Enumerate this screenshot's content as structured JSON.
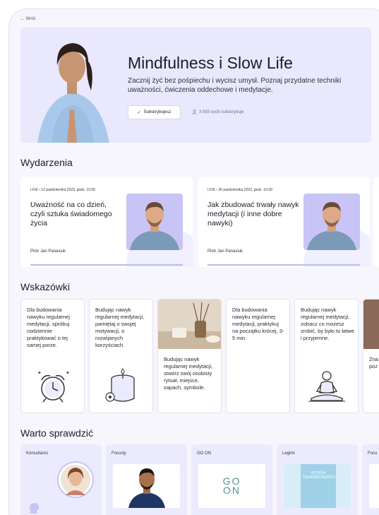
{
  "nav": {
    "back_label": "← Wróć"
  },
  "hero": {
    "title": "Mindfulness i Slow Life",
    "description": "Zacznij żyć bez pośpiechu i wycisz umysł. Poznaj przydatne techniki uważności, ćwiczenia oddechowe i medytacje.",
    "subscribe_label": "Subskrybujesz",
    "subscribe_icon": "check-icon",
    "subscribers_text": "3 893 osób subskrybuje",
    "subscribers_icon": "person-icon"
  },
  "events": {
    "section_title": "Wydarzenia",
    "items": [
      {
        "live": "LIVE",
        "date": "12 października 2023, godz. 10:30",
        "title": "Uważność na co dzień, czyli sztuka świadomego życia",
        "author": "Piotr Jan Panasiuk"
      },
      {
        "live": "LIVE",
        "date": "26 października 2023, godz. 10:30",
        "title": "Jak zbudować trwały nawyk medytacji (i inne dobre nawyki)",
        "author": "Piotr Jan Panasiuk"
      }
    ]
  },
  "tips": {
    "section_title": "Wskazówki",
    "items": [
      {
        "text": "Dla budowania nawyku regularnej medytacji, spróbuj codziennie praktykować o tej samej porze.",
        "illustration": "alarm-clock-icon"
      },
      {
        "text": "Budując nawyk regularnej medytacji, pamiętaj o swojej motywacji, o rozwijanych korzyściach.",
        "illustration": "candle-icon"
      },
      {
        "text": "Budując nawyk regularnej medytacji, stwórz swój osobisty rytuał, miejsce, zapach, symbole.",
        "illustration": "aroma-photo"
      },
      {
        "text": "Dla budowania nawyku regularnej medytacji, praktykuj na początku krócej, 3-5 min.",
        "illustration": ""
      },
      {
        "text": "Budując nawyk regularnej medytacji, zobacz co możesz zrobić, by było to łatwe i przyjemne.",
        "illustration": "meditating-person-icon"
      },
      {
        "text": "Zna coo na n Naw reg poz róż",
        "illustration": "photo"
      }
    ]
  },
  "check": {
    "section_title": "Warto sprawdzić",
    "items": [
      {
        "label": "Konsultanci"
      },
      {
        "label": "Focusly"
      },
      {
        "label": "GO ON",
        "logo_top": "GO",
        "logo_bottom": "ON"
      },
      {
        "label": "Legimi",
        "book_title": "POTĘGA TERAŹNIEJSZOŚCI"
      },
      {
        "label": "Focu"
      }
    ]
  },
  "colors": {
    "accent": "#c8c4f5",
    "hero_bg": "#e9e8fd",
    "live_dot": "#e04464"
  }
}
